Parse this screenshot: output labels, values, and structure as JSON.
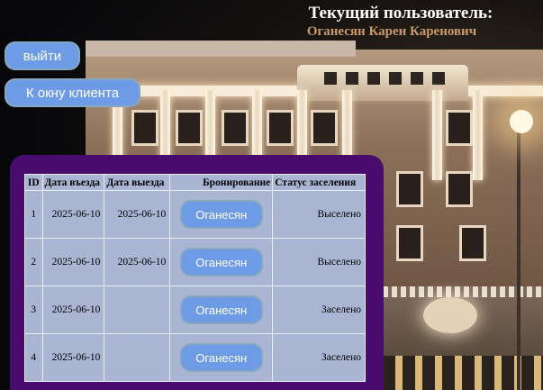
{
  "header": {
    "title": "Текущий пользователь:",
    "user_name": "Оганесян Карен Каренович"
  },
  "actions": {
    "exit_label": "выйти",
    "client_window_label": "К окну клиента"
  },
  "table": {
    "columns": [
      "ID",
      "Дата въезда",
      "Дата выезда",
      "Бронирование",
      "Статус заселения"
    ],
    "rows": [
      {
        "id": "1",
        "check_in": "2025-06-10",
        "check_out": "2025-06-10",
        "booking": "Оганесян",
        "status": "Выселено"
      },
      {
        "id": "2",
        "check_in": "2025-06-10",
        "check_out": "2025-06-10",
        "booking": "Оганесян",
        "status": "Выселено"
      },
      {
        "id": "3",
        "check_in": "2025-06-10",
        "check_out": "",
        "booking": "Оганесян",
        "status": "Заселено"
      },
      {
        "id": "4",
        "check_in": "2025-06-10",
        "check_out": "",
        "booking": "Оганесян",
        "status": "Заселено"
      }
    ]
  },
  "colors": {
    "button": "#6e9be5",
    "panel": "#4a0b6e",
    "table": "#aab5d4",
    "user_name": "#c99a6a"
  }
}
